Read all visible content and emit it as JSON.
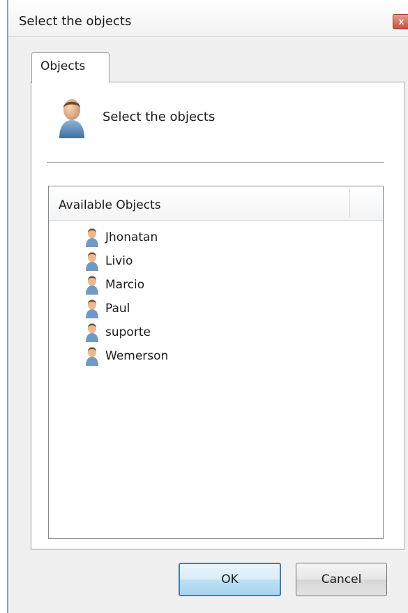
{
  "window": {
    "title": "Select the objects",
    "close_label": "x"
  },
  "tabs": [
    {
      "label": "Objects"
    }
  ],
  "header": {
    "icon": "user-icon",
    "text": "Select the objects"
  },
  "list": {
    "column_header": "Available Objects",
    "items": [
      {
        "label": "Jhonatan",
        "icon": "user-icon"
      },
      {
        "label": "Livio",
        "icon": "user-icon"
      },
      {
        "label": "Marcio",
        "icon": "user-icon"
      },
      {
        "label": "Paul",
        "icon": "user-icon"
      },
      {
        "label": "suporte",
        "icon": "user-icon"
      },
      {
        "label": "Wemerson",
        "icon": "user-icon"
      }
    ]
  },
  "buttons": {
    "ok_label": "OK",
    "cancel_label": "Cancel"
  },
  "colors": {
    "accent_border": "#3c7fb1",
    "close_button": "#c7503a"
  }
}
